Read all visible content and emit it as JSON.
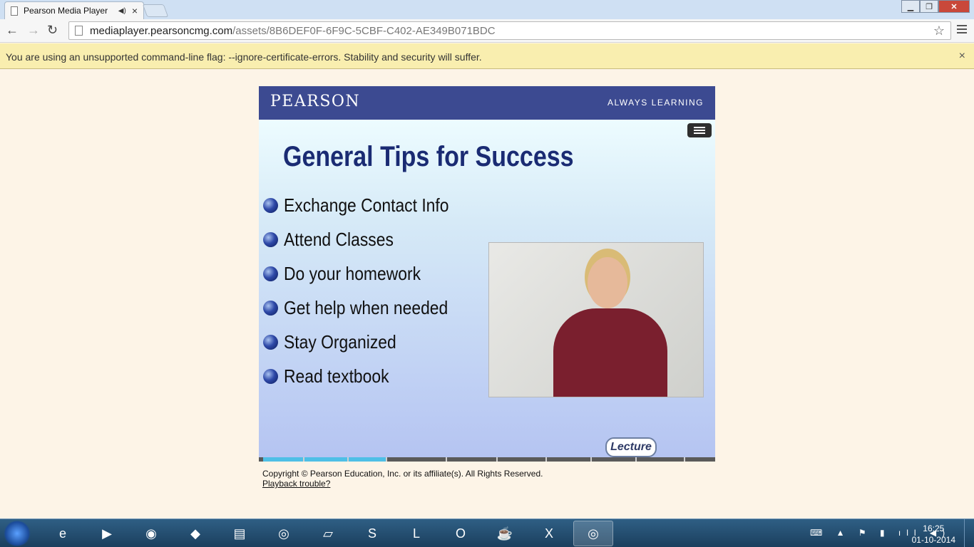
{
  "browser": {
    "tab_title": "Pearson Media Player",
    "tab_close": "×",
    "blurred_tab_text": "",
    "window_buttons": {
      "minimize": "▁",
      "restore": "❐",
      "close": "✕"
    },
    "nav": {
      "back": "←",
      "forward": "→",
      "reload": "↻"
    },
    "url_host": "mediaplayer.pearsoncmg.com",
    "url_path": "/assets/8B6DEF0F-6F9C-5CBF-C402-AE349B071BDC",
    "star": "☆"
  },
  "infobar": {
    "message": "You are using an unsupported command-line flag: --ignore-certificate-errors. Stability and security will suffer.",
    "close": "×"
  },
  "player": {
    "brand": "PEARSON",
    "slogan": "ALWAYS LEARNING",
    "slide_title": "General Tips for Success",
    "bullets": [
      "Exchange Contact Info",
      "Attend Classes",
      "Do your homework",
      "Get help when needed",
      "Stay Organized",
      "Read textbook"
    ],
    "lecture_badge": "Lecture",
    "progress_fraction": 0.28,
    "copyright": "Copyright © Pearson Education, Inc. or its affiliate(s). All Rights Reserved.",
    "playback_link": "Playback trouble?"
  },
  "taskbar": {
    "apps": [
      {
        "name": "internet-explorer",
        "glyph": "e"
      },
      {
        "name": "media-player",
        "glyph": "▶"
      },
      {
        "name": "firefox",
        "glyph": "◉"
      },
      {
        "name": "android",
        "glyph": "◆"
      },
      {
        "name": "file-explorer",
        "glyph": "▤"
      },
      {
        "name": "chrome",
        "glyph": "◎"
      },
      {
        "name": "sticky-notes",
        "glyph": "▱"
      },
      {
        "name": "skype",
        "glyph": "S"
      },
      {
        "name": "lync",
        "glyph": "L"
      },
      {
        "name": "outlook",
        "glyph": "O"
      },
      {
        "name": "eclipse-java-ee",
        "glyph": "☕"
      },
      {
        "name": "excel",
        "glyph": "X"
      },
      {
        "name": "chrome-active",
        "glyph": "◎"
      }
    ],
    "time": "16:25",
    "date": "01-10-2014"
  }
}
